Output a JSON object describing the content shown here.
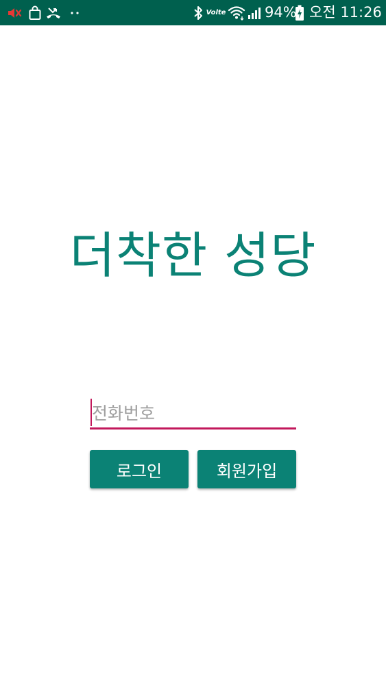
{
  "status_bar": {
    "battery": "94%",
    "clock": "오전 11:26",
    "volte": "Volte",
    "background_color": "#00604e",
    "left_icons": [
      "volume-mute-icon",
      "shopping-bag-icon",
      "missed-call-icon",
      "more-dots-icon"
    ],
    "right_icons": [
      "bluetooth-icon",
      "volte-icon",
      "wifi-icon",
      "signal-icon",
      "battery-charging-icon"
    ]
  },
  "main": {
    "title": "더착한 성당",
    "title_color": "#0b8275"
  },
  "form": {
    "phone_placeholder": "전화번호",
    "phone_value": "",
    "accent_color": "#c2185b",
    "login_label": "로그인",
    "signup_label": "회원가입",
    "button_color": "#0b8275"
  }
}
